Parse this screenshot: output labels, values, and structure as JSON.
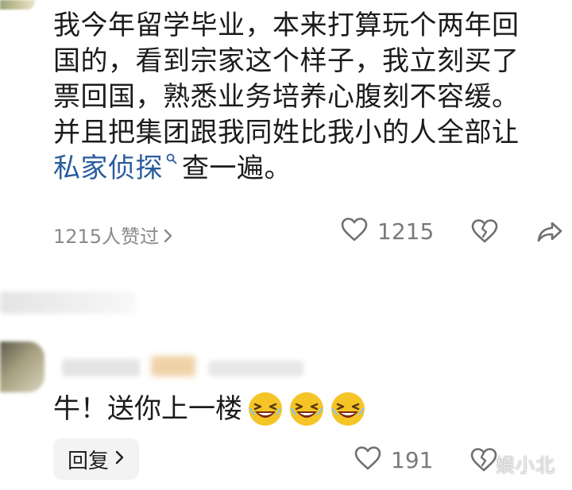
{
  "comment1": {
    "line1": "我今年留学毕业，本来打算玩个两年回",
    "line2": "国的，看到宗家这个样子，我立刻买了",
    "line3": "票回国，熟悉业务培养心腹刻不容缓。",
    "line4": "并且把集团跟我同姓比我小的人全部让",
    "link_text": "私家侦探",
    "line5_tail": "查一遍。",
    "liked_by": "1215人赞过",
    "like_count": "1215"
  },
  "comment2": {
    "text": "牛！送你上一楼",
    "reply_label": "回复",
    "like_count": "191"
  },
  "watermark": "娱小北",
  "icons": {
    "link_search": "search-icon",
    "chevron": "chevron-right-icon",
    "like": "heart-outline-icon",
    "dislike": "broken-heart-icon",
    "share": "share-arrow-icon",
    "emoji": "laughing-emoji-icon"
  },
  "colors": {
    "link": "#2a5c9e",
    "muted": "#8a8a8a",
    "emoji_yellow": "#f5c426"
  }
}
